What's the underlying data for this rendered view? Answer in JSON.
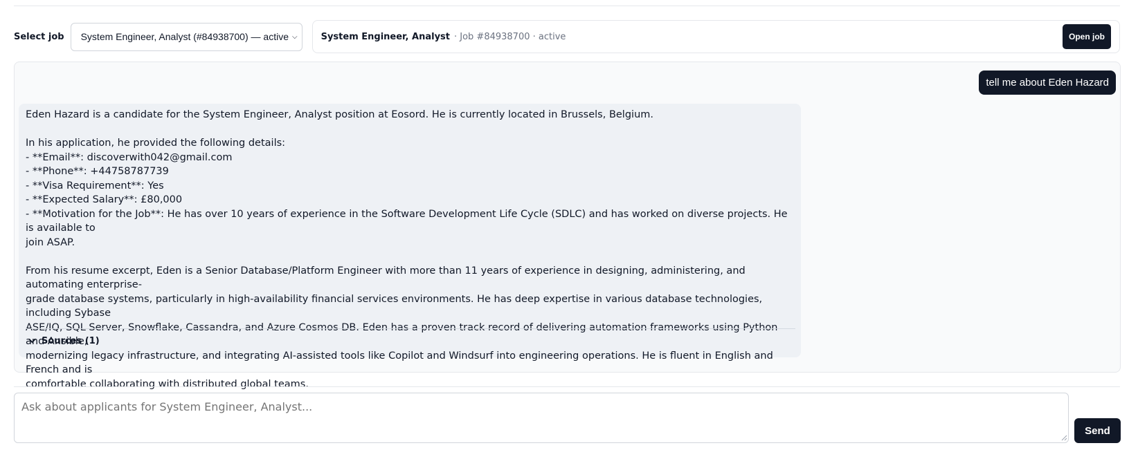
{
  "job_bar": {
    "select_label": "Select job",
    "selected_job": "System Engineer, Analyst (#84938700) — active",
    "summary_title": "System Engineer, Analyst",
    "summary_meta": "· Job #84938700 · active",
    "open_button": "Open job"
  },
  "chat": {
    "user_message": "tell me about Eden Hazard",
    "assistant_message": "Eden Hazard is a candidate for the System Engineer, Analyst position at Eosord. He is currently located in Brussels, Belgium.\n\nIn his application, he provided the following details:\n- **Email**: discoverwith042@gmail.com\n- **Phone**: +44758787739\n- **Visa Requirement**: Yes\n- **Expected Salary**: £80,000\n- **Motivation for the Job**: He has over 10 years of experience in the Software Development Life Cycle (SDLC) and has worked on diverse projects. He is available to\njoin ASAP.\n\nFrom his resume excerpt, Eden is a Senior Database/Platform Engineer with more than 11 years of experience in designing, administering, and automating enterprise-\ngrade database systems, particularly in high-availability financial services environments. He has deep expertise in various database technologies, including Sybase\nASE/IQ, SQL Server, Snowflake, Cassandra, and Azure Cosmos DB. Eden has a proven track record of delivering automation frameworks using Python and Ansible,\nmodernizing legacy infrastructure, and integrating AI-assisted tools like Copilot and Windsurf into engineering operations. He is fluent in English and French and is\ncomfortable collaborating with distributed global teams.",
    "sources_label": "Sources (1)"
  },
  "composer": {
    "placeholder": "Ask about applicants for System Engineer, Analyst...",
    "send_button": "Send"
  },
  "icons": {
    "select_chevron": "chevron-down-icon",
    "sources_chevron": "chevron-down-icon",
    "resize_grip": "resize-grip-icon"
  },
  "colors": {
    "primary_button": "#111827",
    "assistant_bubble": "#eef1f5",
    "muted_text": "#6b7280"
  }
}
